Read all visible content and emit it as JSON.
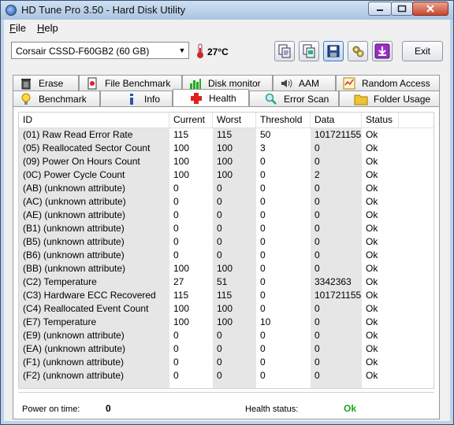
{
  "window": {
    "title": "HD Tune Pro 3.50 - Hard Disk Utility"
  },
  "menu": {
    "file": "File",
    "help": "Help"
  },
  "toolbar": {
    "drive": "Corsair CSSD-F60GB2 (60 GB)",
    "temperature": "27°C",
    "exit_label": "Exit",
    "icons": [
      "copy-text-icon",
      "copy-screenshot-icon",
      "save-icon",
      "options-icon",
      "download-icon"
    ]
  },
  "tabs": {
    "row1": [
      {
        "label": "Erase",
        "icon": "trash-icon"
      },
      {
        "label": "File Benchmark",
        "icon": "file-benchmark-icon"
      },
      {
        "label": "Disk monitor",
        "icon": "disk-monitor-icon"
      },
      {
        "label": "AAM",
        "icon": "speaker-icon"
      },
      {
        "label": "Random Access",
        "icon": "random-access-icon"
      }
    ],
    "row2": [
      {
        "label": "Benchmark",
        "icon": "lightbulb-icon"
      },
      {
        "label": "Info",
        "icon": "info-icon"
      },
      {
        "label": "Health",
        "icon": "health-cross-icon",
        "active": true
      },
      {
        "label": "Error Scan",
        "icon": "magnifier-icon"
      },
      {
        "label": "Folder Usage",
        "icon": "folder-icon"
      }
    ]
  },
  "health": {
    "columns": [
      "ID",
      "Current",
      "Worst",
      "Threshold",
      "Data",
      "Status"
    ],
    "rows": [
      [
        "(01) Raw Read Error Rate",
        "115",
        "115",
        "50",
        "101721155",
        "Ok"
      ],
      [
        "(05) Reallocated Sector Count",
        "100",
        "100",
        "3",
        "0",
        "Ok"
      ],
      [
        "(09) Power On Hours Count",
        "100",
        "100",
        "0",
        "0",
        "Ok"
      ],
      [
        "(0C) Power Cycle Count",
        "100",
        "100",
        "0",
        "2",
        "Ok"
      ],
      [
        "(AB) (unknown attribute)",
        "0",
        "0",
        "0",
        "0",
        "Ok"
      ],
      [
        "(AC) (unknown attribute)",
        "0",
        "0",
        "0",
        "0",
        "Ok"
      ],
      [
        "(AE) (unknown attribute)",
        "0",
        "0",
        "0",
        "0",
        "Ok"
      ],
      [
        "(B1) (unknown attribute)",
        "0",
        "0",
        "0",
        "0",
        "Ok"
      ],
      [
        "(B5) (unknown attribute)",
        "0",
        "0",
        "0",
        "0",
        "Ok"
      ],
      [
        "(B6) (unknown attribute)",
        "0",
        "0",
        "0",
        "0",
        "Ok"
      ],
      [
        "(BB) (unknown attribute)",
        "100",
        "100",
        "0",
        "0",
        "Ok"
      ],
      [
        "(C2) Temperature",
        "27",
        "51",
        "0",
        "3342363",
        "Ok"
      ],
      [
        "(C3) Hardware ECC Recovered",
        "115",
        "115",
        "0",
        "101721155",
        "Ok"
      ],
      [
        "(C4) Reallocated Event Count",
        "100",
        "100",
        "0",
        "0",
        "Ok"
      ],
      [
        "(E7) Temperature",
        "100",
        "100",
        "10",
        "0",
        "Ok"
      ],
      [
        "(E9) (unknown attribute)",
        "0",
        "0",
        "0",
        "0",
        "Ok"
      ],
      [
        "(EA) (unknown attribute)",
        "0",
        "0",
        "0",
        "0",
        "Ok"
      ],
      [
        "(F1) (unknown attribute)",
        "0",
        "0",
        "0",
        "0",
        "Ok"
      ],
      [
        "(F2) (unknown attribute)",
        "0",
        "0",
        "0",
        "0",
        "Ok"
      ]
    ]
  },
  "footer": {
    "power_on_label": "Power on time:",
    "power_on_value": "0",
    "health_status_label": "Health status:",
    "health_status_value": "Ok",
    "health_status_color": "#1fa51f"
  }
}
